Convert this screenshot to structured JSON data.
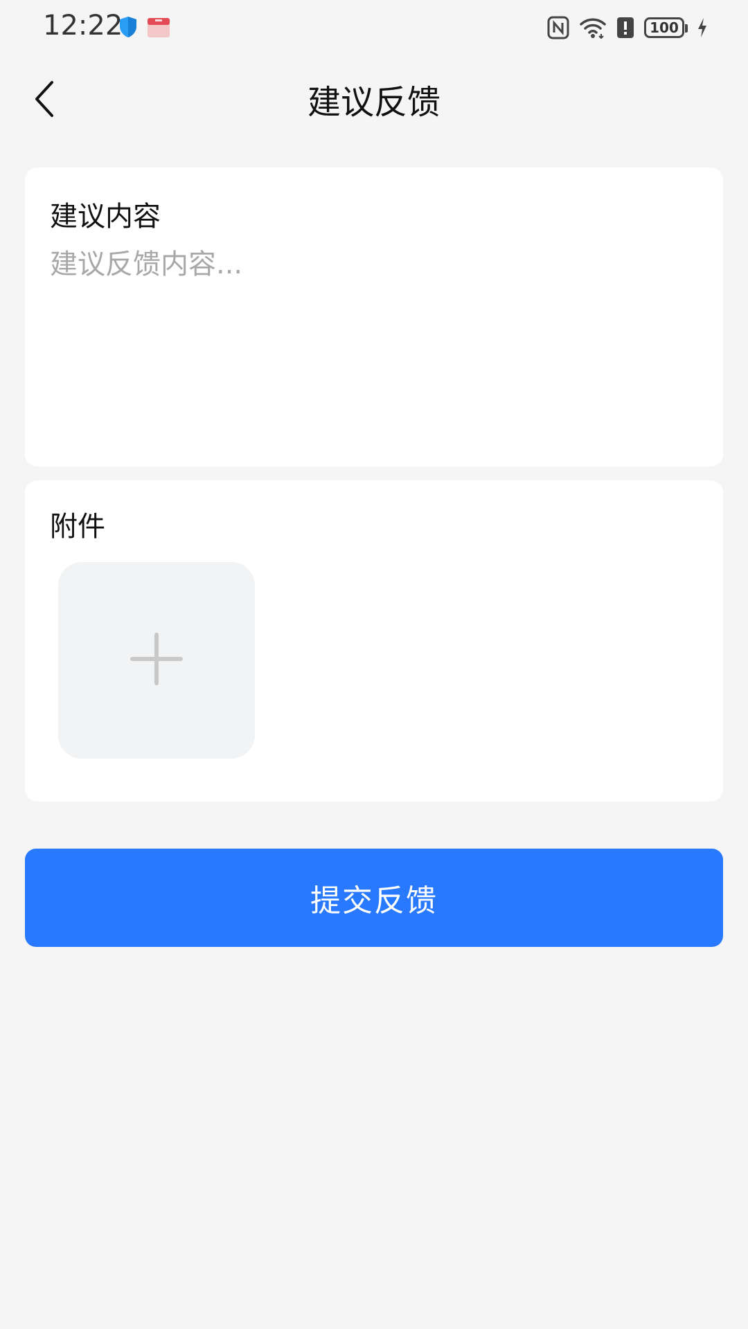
{
  "status_bar": {
    "time": "12:22",
    "battery": "100",
    "left_icons": [
      "shield-icon",
      "app-box-icon"
    ],
    "right_icons": [
      "nfc-icon",
      "wifi-icon",
      "alert-icon",
      "battery-icon",
      "charging-icon"
    ]
  },
  "nav": {
    "title": "建议反馈",
    "back_icon": "chevron-left-icon"
  },
  "content_card": {
    "label": "建议内容",
    "placeholder": "建议反馈内容...",
    "value": ""
  },
  "attachment_card": {
    "label": "附件",
    "add_icon": "plus-icon"
  },
  "submit": {
    "label": "提交反馈"
  },
  "colors": {
    "background": "#f5f5f5",
    "card": "#ffffff",
    "accent": "#2979ff",
    "placeholder": "#a8a8a8",
    "upload_box": "#f2f3f5"
  }
}
